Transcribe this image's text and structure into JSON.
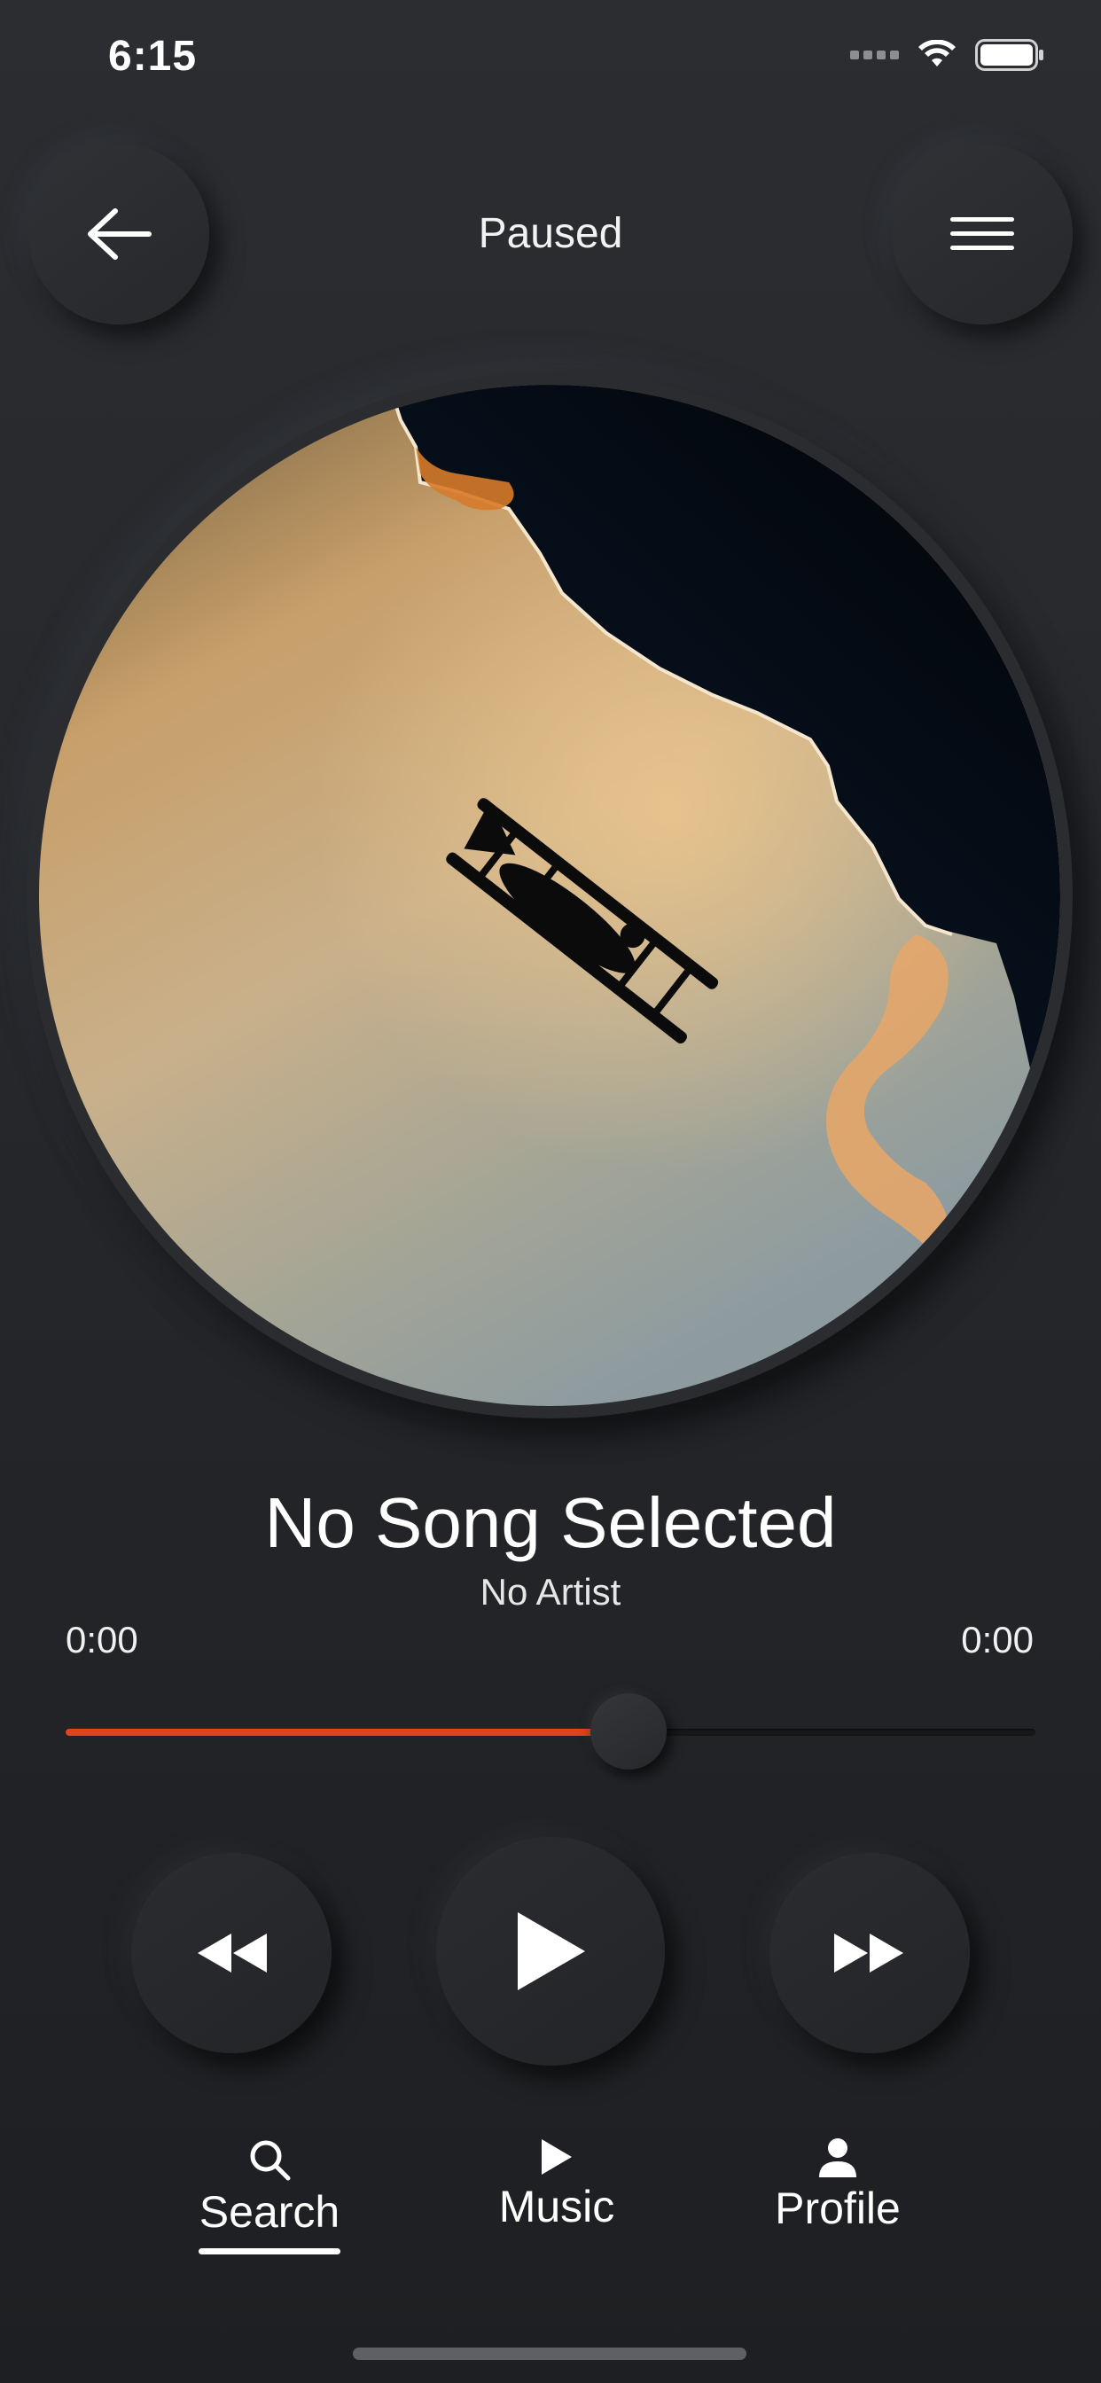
{
  "status_bar": {
    "time": "6:15"
  },
  "header": {
    "status": "Paused"
  },
  "song": {
    "title": "No Song Selected",
    "artist": "No Artist"
  },
  "progress": {
    "elapsed": "0:00",
    "duration": "0:00",
    "fraction": 0.58
  },
  "controls": {
    "rewind_icon": "rewind-icon",
    "play_icon": "play-icon",
    "forward_icon": "fast-forward-icon"
  },
  "nav": {
    "items": [
      {
        "label": "Search",
        "icon": "search-icon",
        "active": true
      },
      {
        "label": "Music",
        "icon": "play-icon",
        "active": false
      },
      {
        "label": "Profile",
        "icon": "person-icon",
        "active": false
      }
    ]
  },
  "colors": {
    "accent": "#e2431a",
    "background": "#25272b"
  }
}
